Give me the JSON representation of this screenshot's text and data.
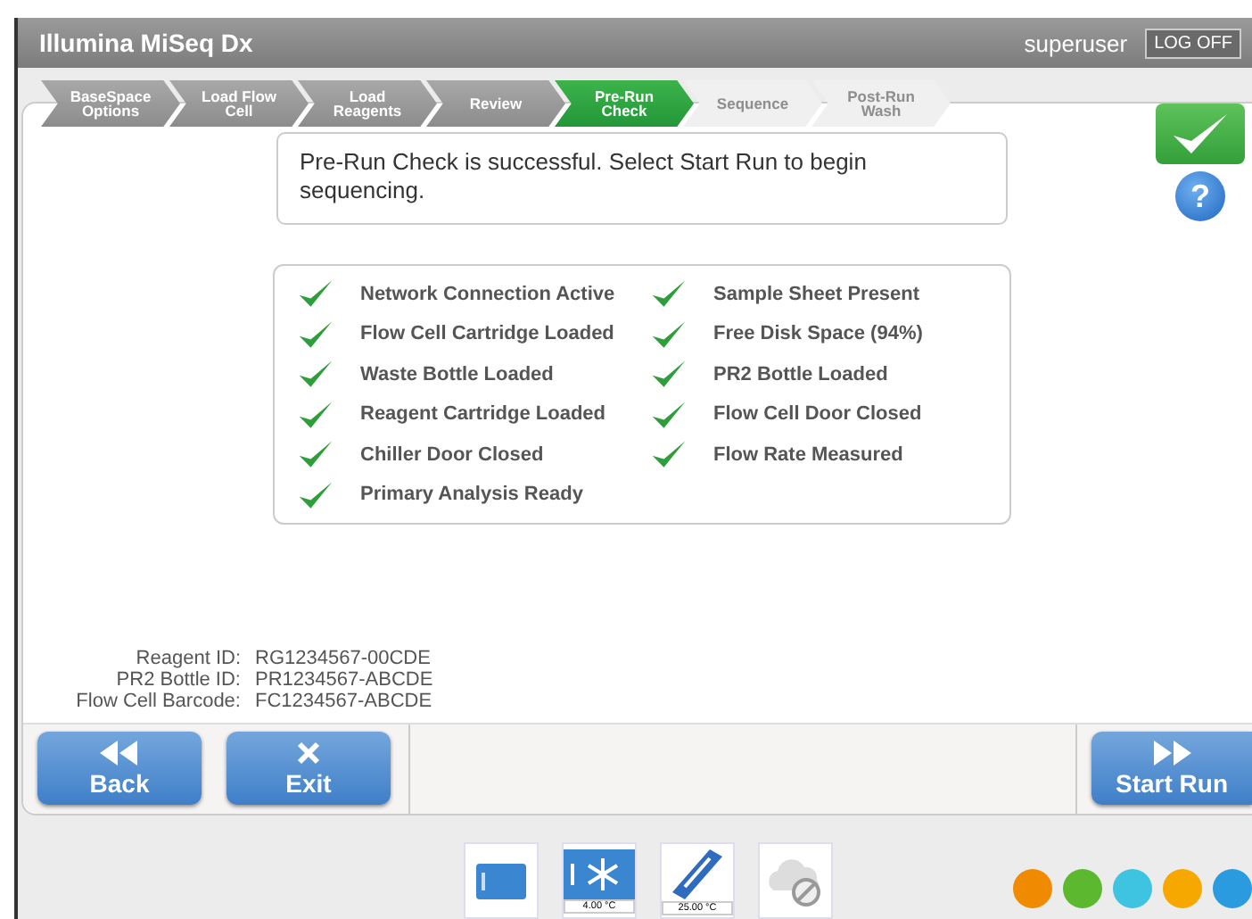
{
  "window": {
    "title": "Illumina MiSeq Dx",
    "user": "superuser",
    "logoff": "LOG OFF"
  },
  "steps": [
    {
      "label": "BaseSpace Options",
      "completed": true,
      "selected": false
    },
    {
      "label": "Load Flow Cell",
      "completed": true,
      "selected": false
    },
    {
      "label": "Load Reagents",
      "completed": true,
      "selected": false
    },
    {
      "label": "Review",
      "completed": true,
      "selected": false
    },
    {
      "label": "Pre-Run Check",
      "completed": false,
      "selected": true
    },
    {
      "label": "Sequence",
      "completed": false,
      "selected": false
    },
    {
      "label": "Post-Run Wash",
      "completed": false,
      "selected": false
    }
  ],
  "help": "?",
  "message": "Pre-Run Check is successful. Select Start Run to begin sequencing.",
  "checks": {
    "left_column": [
      {
        "label": "Network Connection Active",
        "passed": true
      },
      {
        "label": "Flow Cell Cartridge Loaded",
        "passed": true
      },
      {
        "label": "Waste Bottle Loaded",
        "passed": true
      },
      {
        "label": "Reagent Cartridge Loaded",
        "passed": true
      },
      {
        "label": "Chiller Door Closed",
        "passed": true
      },
      {
        "label": "Primary Analysis Ready",
        "passed": true
      }
    ],
    "right_column": [
      {
        "label": "Sample Sheet Present",
        "passed": true
      },
      {
        "label": "Free Disk Space (94%)",
        "passed": true
      },
      {
        "label": "PR2 Bottle Loaded",
        "passed": true
      },
      {
        "label": "Flow Cell Door Closed",
        "passed": true
      },
      {
        "label": "Flow Rate Measured",
        "passed": true
      }
    ]
  },
  "ids": [
    {
      "label": "Reagent ID:",
      "value": "RG1234567-00CDE"
    },
    {
      "label": "PR2 Bottle ID:",
      "value": "PR1234567-ABCDE"
    },
    {
      "label": "Flow Cell Barcode:",
      "value": "FC1234567-ABCDE"
    }
  ],
  "buttons": [
    {
      "label": "Back",
      "kind": "back"
    },
    {
      "label": "Exit",
      "kind": "exit"
    },
    {
      "label": "Start Run",
      "kind": "start"
    }
  ],
  "status_bar": {
    "tiles": [
      {
        "kind": "flowcell"
      },
      {
        "kind": "chiller",
        "reading": "4.00 °C"
      },
      {
        "kind": "stage",
        "reading": "25.00 °C"
      },
      {
        "kind": "cloud"
      }
    ],
    "indicators": [
      {
        "color": "#f08a00"
      },
      {
        "color": "#5cb82e"
      },
      {
        "color": "#3ec3e0"
      },
      {
        "color": "#f7a800"
      },
      {
        "color": "#2b9be0"
      }
    ]
  }
}
